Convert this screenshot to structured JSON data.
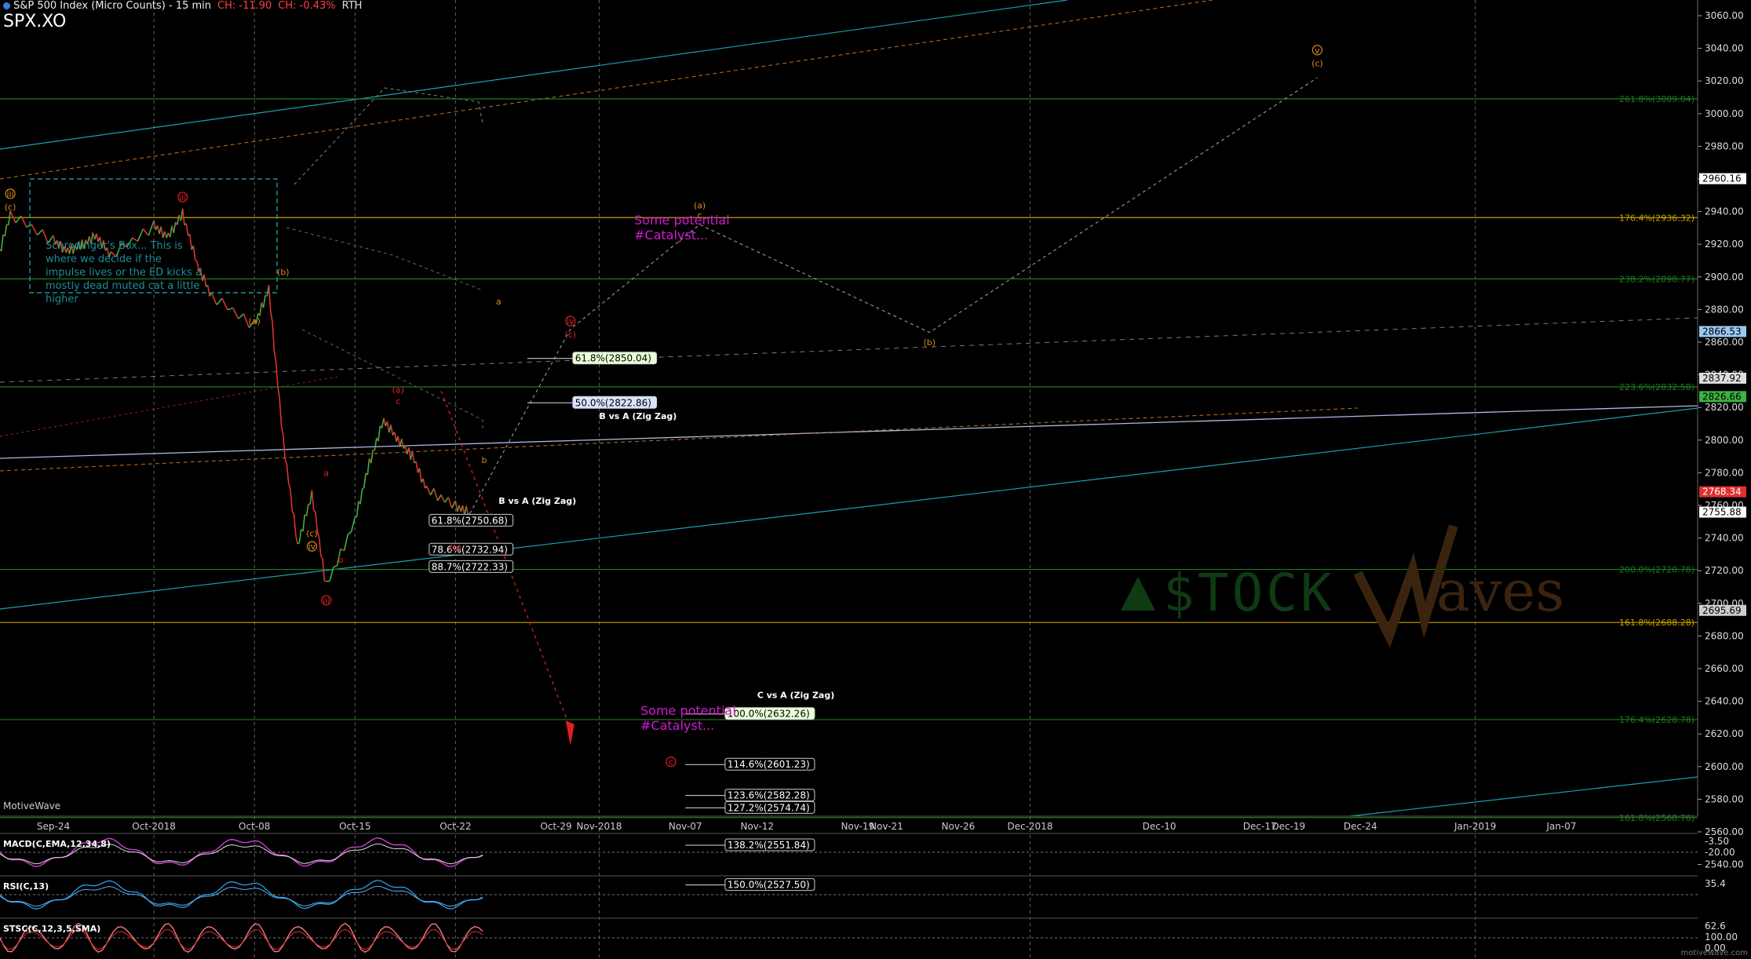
{
  "header": {
    "title": "S&P 500 Index (Micro Counts) - 15 min",
    "change": "CH: -11.90",
    "change_pct": "CH: -0.43%",
    "session": "RTH",
    "symbol": "SPX.XO"
  },
  "branding": {
    "platform": "MotiveWave",
    "watermark": "motivewave.com",
    "logo": "STOCKWaves"
  },
  "colors": {
    "background": "#000000",
    "up": "#3cb043",
    "down": "#e03030",
    "wave_orange": "#d98a1c",
    "wave_red": "#e02020",
    "fib_green": "#1e7d1e",
    "fib_yellow": "#c8a000",
    "catalyst": "#d21ad2",
    "box": "#1e8e95"
  },
  "notes": {
    "schrodinger": "Schrodinger's Box... This is where we decide if the impulse lives or the ED kicks a mostly dead muted cat a little higher",
    "catalyst_1": "Some potential\n#Catalyst...",
    "catalyst_2": "Some potential\n#Catalyst..."
  },
  "chart_data": {
    "type": "line",
    "title": "S&P 500 Index (Micro Counts) - 15 min",
    "ylim": [
      2520,
      3070
    ],
    "y_ticks": [
      "3060.00",
      "3040.00",
      "3020.00",
      "3000.00",
      "2980.00",
      "2960.00",
      "2940.00",
      "2920.00",
      "2900.00",
      "2880.00",
      "2860.00",
      "2840.00",
      "2820.00",
      "2800.00",
      "2780.00",
      "2760.00",
      "2740.00",
      "2720.00",
      "2700.00",
      "2680.00",
      "2660.00",
      "2640.00",
      "2620.00",
      "2600.00",
      "2580.00",
      "2560.00",
      "2540.00"
    ],
    "x_ticks": [
      {
        "label": "Sep-24",
        "x": "2018-09-24"
      },
      {
        "label": "Oct-2018",
        "x": "2018-10-01"
      },
      {
        "label": "Oct-08",
        "x": "2018-10-08"
      },
      {
        "label": "Oct-15",
        "x": "2018-10-15"
      },
      {
        "label": "Oct-22",
        "x": "2018-10-22"
      },
      {
        "label": "Oct-29",
        "x": "2018-10-29"
      },
      {
        "label": "Nov-2018",
        "x": "2018-11-01"
      },
      {
        "label": "Nov-07",
        "x": "2018-11-07"
      },
      {
        "label": "Nov-12",
        "x": "2018-11-12"
      },
      {
        "label": "Nov-19",
        "x": "2018-11-19"
      },
      {
        "label": "Nov-21",
        "x": "2018-11-21"
      },
      {
        "label": "Nov-26",
        "x": "2018-11-26"
      },
      {
        "label": "Dec-2018",
        "x": "2018-12-01"
      },
      {
        "label": "Dec-10",
        "x": "2018-12-10"
      },
      {
        "label": "Dec-17",
        "x": "2018-12-17"
      },
      {
        "label": "Dec-19",
        "x": "2018-12-19"
      },
      {
        "label": "Dec-24",
        "x": "2018-12-24"
      },
      {
        "label": "Jan-2019",
        "x": "2019-01-01"
      },
      {
        "label": "Jan-07",
        "x": "2019-01-07"
      }
    ],
    "series": [
      {
        "values": [
          [
            "2018-09-20",
            2907
          ],
          [
            "2018-09-21",
            2938
          ],
          [
            "2018-09-24",
            2922
          ],
          [
            "2018-09-25",
            2916
          ],
          [
            "2018-09-26",
            2920
          ],
          [
            "2018-09-27",
            2925
          ],
          [
            "2018-09-28",
            2913
          ],
          [
            "2018-10-01",
            2931
          ],
          [
            "2018-10-02",
            2925
          ],
          [
            "2018-10-03",
            2939
          ],
          [
            "2018-10-04",
            2908
          ],
          [
            "2018-10-05",
            2888
          ],
          [
            "2018-10-08",
            2870
          ],
          [
            "2018-10-09",
            2893
          ],
          [
            "2018-10-10",
            2800
          ],
          [
            "2018-10-11",
            2735
          ],
          [
            "2018-10-12",
            2767
          ],
          [
            "2018-10-13",
            2710
          ],
          [
            "2018-10-15",
            2751
          ],
          [
            "2018-10-16",
            2786
          ],
          [
            "2018-10-17",
            2812
          ],
          [
            "2018-10-18",
            2800
          ],
          [
            "2018-10-19",
            2790
          ],
          [
            "2018-10-20",
            2770
          ],
          [
            "2018-10-22",
            2760
          ],
          [
            "2018-10-23",
            2755
          ]
        ]
      }
    ],
    "price_labels": [
      {
        "value": "2960.16",
        "y": 2960.16,
        "color": "#ffffff",
        "text": "#000"
      },
      {
        "value": "2866.53",
        "y": 2866.53,
        "color": "#9cc7f0",
        "text": "#000"
      },
      {
        "value": "2837.92",
        "y": 2837.92,
        "color": "#dddddd",
        "text": "#000"
      },
      {
        "value": "2826.66",
        "y": 2826.66,
        "color": "#3cb043",
        "text": "#000"
      },
      {
        "value": "2768.34",
        "y": 2768.34,
        "color": "#e03030",
        "text": "#fff"
      },
      {
        "value": "2755.88",
        "y": 2755.88,
        "color": "#ffffff",
        "text": "#000"
      },
      {
        "value": "2695.69",
        "y": 2695.69,
        "color": "#cccccc",
        "text": "#000"
      }
    ],
    "fib_levels": [
      {
        "label": "261.8%(3009.04)",
        "y": 3009.04,
        "color": "#1e7d1e"
      },
      {
        "label": "176.4%(2936.32)",
        "y": 2936.32,
        "color": "#c8a000"
      },
      {
        "label": "238.2%(2898.77)",
        "y": 2898.77,
        "color": "#1e7d1e"
      },
      {
        "label": "223.6%(2832.58)",
        "y": 2832.58,
        "color": "#1e7d1e"
      },
      {
        "label": "200.0%(2720.78)",
        "y": 2720.78,
        "color": "#1e7d1e"
      },
      {
        "label": "161.8%(2688.28)",
        "y": 2688.28,
        "color": "#c8a000"
      },
      {
        "label": "176.4%(2628.78)",
        "y": 2628.78,
        "color": "#1e7d1e"
      },
      {
        "label": "161.8%(2568.76)",
        "y": 2568.76,
        "color": "#1e7d1e"
      }
    ],
    "fib_boxes": [
      {
        "label": "61.8%(2850.04)",
        "y": 2850.04,
        "x1": "2018-10-27",
        "x2": "2018-11-05",
        "bg": "#eaffd8"
      },
      {
        "label": "50.0%(2822.86)",
        "y": 2822.86,
        "x1": "2018-10-27",
        "x2": "2018-11-05",
        "bg": "#d8e4ff"
      },
      {
        "label": "61.8%(2750.68)",
        "y": 2750.68,
        "x1": "2018-10-23",
        "x2": "2018-10-26",
        "bg": "#000"
      },
      {
        "label": "78.6%(2732.94)",
        "y": 2732.94,
        "x1": "2018-10-23",
        "x2": "2018-10-26",
        "bg": "#000"
      },
      {
        "label": "88.7%(2722.33)",
        "y": 2722.33,
        "x1": "2018-10-23",
        "x2": "2018-10-26",
        "bg": "#000"
      },
      {
        "label": "100.0%(2632.26)",
        "y": 2632.26,
        "x1": "2018-11-07",
        "x2": "2018-11-16",
        "bg": "#eaffd8"
      },
      {
        "label": "114.6%(2601.23)",
        "y": 2601.23,
        "x1": "2018-11-07",
        "x2": "2018-11-16",
        "bg": "#000"
      },
      {
        "label": "123.6%(2582.28)",
        "y": 2582.28,
        "x1": "2018-11-07",
        "x2": "2018-11-16",
        "bg": "#000"
      },
      {
        "label": "127.2%(2574.74)",
        "y": 2574.74,
        "x1": "2018-11-07",
        "x2": "2018-11-16",
        "bg": "#000"
      },
      {
        "label": "138.2%(2551.84)",
        "y": 2551.84,
        "x1": "2018-11-07",
        "x2": "2018-11-16",
        "bg": "#000"
      },
      {
        "label": "150.0%(2527.50)",
        "y": 2527.5,
        "x1": "2018-11-07",
        "x2": "2018-11-16",
        "bg": "#000"
      }
    ],
    "fib_titles": [
      {
        "label": "B vs A (Zig Zag)",
        "x": "2018-11-01",
        "y": 2813
      },
      {
        "label": "B vs A (Zig Zag)",
        "x": "2018-10-25",
        "y": 2761
      },
      {
        "label": "C vs A (Zig Zag)",
        "x": "2018-11-12",
        "y": 2642
      }
    ],
    "wave_labels": [
      {
        "t": "iii",
        "x": "2018-09-21",
        "y": 2949,
        "c": "#d98a1c",
        "circle": true
      },
      {
        "t": "(c)",
        "x": "2018-09-21",
        "y": 2941,
        "c": "#d98a1c"
      },
      {
        "t": "iii",
        "x": "2018-10-03",
        "y": 2947,
        "c": "#e02020",
        "circle": true
      },
      {
        "t": "(b)",
        "x": "2018-10-10",
        "y": 2901,
        "c": "#d98a1c"
      },
      {
        "t": "(a)",
        "x": "2018-10-08",
        "y": 2871,
        "c": "#d98a1c"
      },
      {
        "t": "a",
        "x": "2018-10-13",
        "y": 2778,
        "c": "#e02020"
      },
      {
        "t": "(c)",
        "x": "2018-10-12",
        "y": 2741,
        "c": "#d98a1c"
      },
      {
        "t": "iv",
        "x": "2018-10-12",
        "y": 2733,
        "c": "#d98a1c",
        "circle": true
      },
      {
        "t": "b",
        "x": "2018-10-14",
        "y": 2725,
        "c": "#e02020"
      },
      {
        "t": "iii",
        "x": "2018-10-13",
        "y": 2700,
        "c": "#e02020",
        "circle": true
      },
      {
        "t": "(a)",
        "x": "2018-10-18",
        "y": 2829,
        "c": "#e02020"
      },
      {
        "t": "c",
        "x": "2018-10-18",
        "y": 2822,
        "c": "#e02020"
      },
      {
        "t": "b",
        "x": "2018-10-24",
        "y": 2786,
        "c": "#d98a1c"
      },
      {
        "t": "(b)",
        "x": "2018-10-22",
        "y": 2732,
        "c": "#e02020"
      },
      {
        "t": "a",
        "x": "2018-10-25",
        "y": 2883,
        "c": "#d98a1c"
      },
      {
        "t": "iv",
        "x": "2018-10-30",
        "y": 2871,
        "c": "#e02020",
        "circle": true
      },
      {
        "t": "(c)",
        "x": "2018-10-30",
        "y": 2863,
        "c": "#e02020"
      },
      {
        "t": "(a)",
        "x": "2018-11-08",
        "y": 2942,
        "c": "#d98a1c"
      },
      {
        "t": "c",
        "x": "2018-11-08",
        "y": 2936,
        "c": "#d98a1c"
      },
      {
        "t": "(b)",
        "x": "2018-11-24",
        "y": 2858,
        "c": "#d98a1c"
      },
      {
        "t": "v",
        "x": "2018-12-21",
        "y": 3037,
        "c": "#d98a1c",
        "circle": true
      },
      {
        "t": "(c)",
        "x": "2018-12-21",
        "y": 3029,
        "c": "#d98a1c"
      },
      {
        "t": "c",
        "x": "2018-11-06",
        "y": 2601,
        "c": "#e02020",
        "circle": true
      }
    ]
  },
  "indicators": [
    {
      "name": "MACD(C,EMA,12,26,9)",
      "display": "MACD(C,EMA,12,34,8)",
      "values": [
        "-3.50",
        "-20.00"
      ],
      "colors": [
        "#e040e0",
        "#dddddd"
      ]
    },
    {
      "name": "RSI",
      "display": "RSI(C,13)",
      "values": [
        "35.4"
      ],
      "colors": [
        "#2aa0e0",
        "#5ab0ff"
      ]
    },
    {
      "name": "STOCH",
      "display": "STSC(C,12,3,5,SMA)",
      "values": [
        "62.6",
        "100.00",
        "0.00"
      ],
      "colors": [
        "#ff8080",
        "#e03030"
      ]
    }
  ]
}
